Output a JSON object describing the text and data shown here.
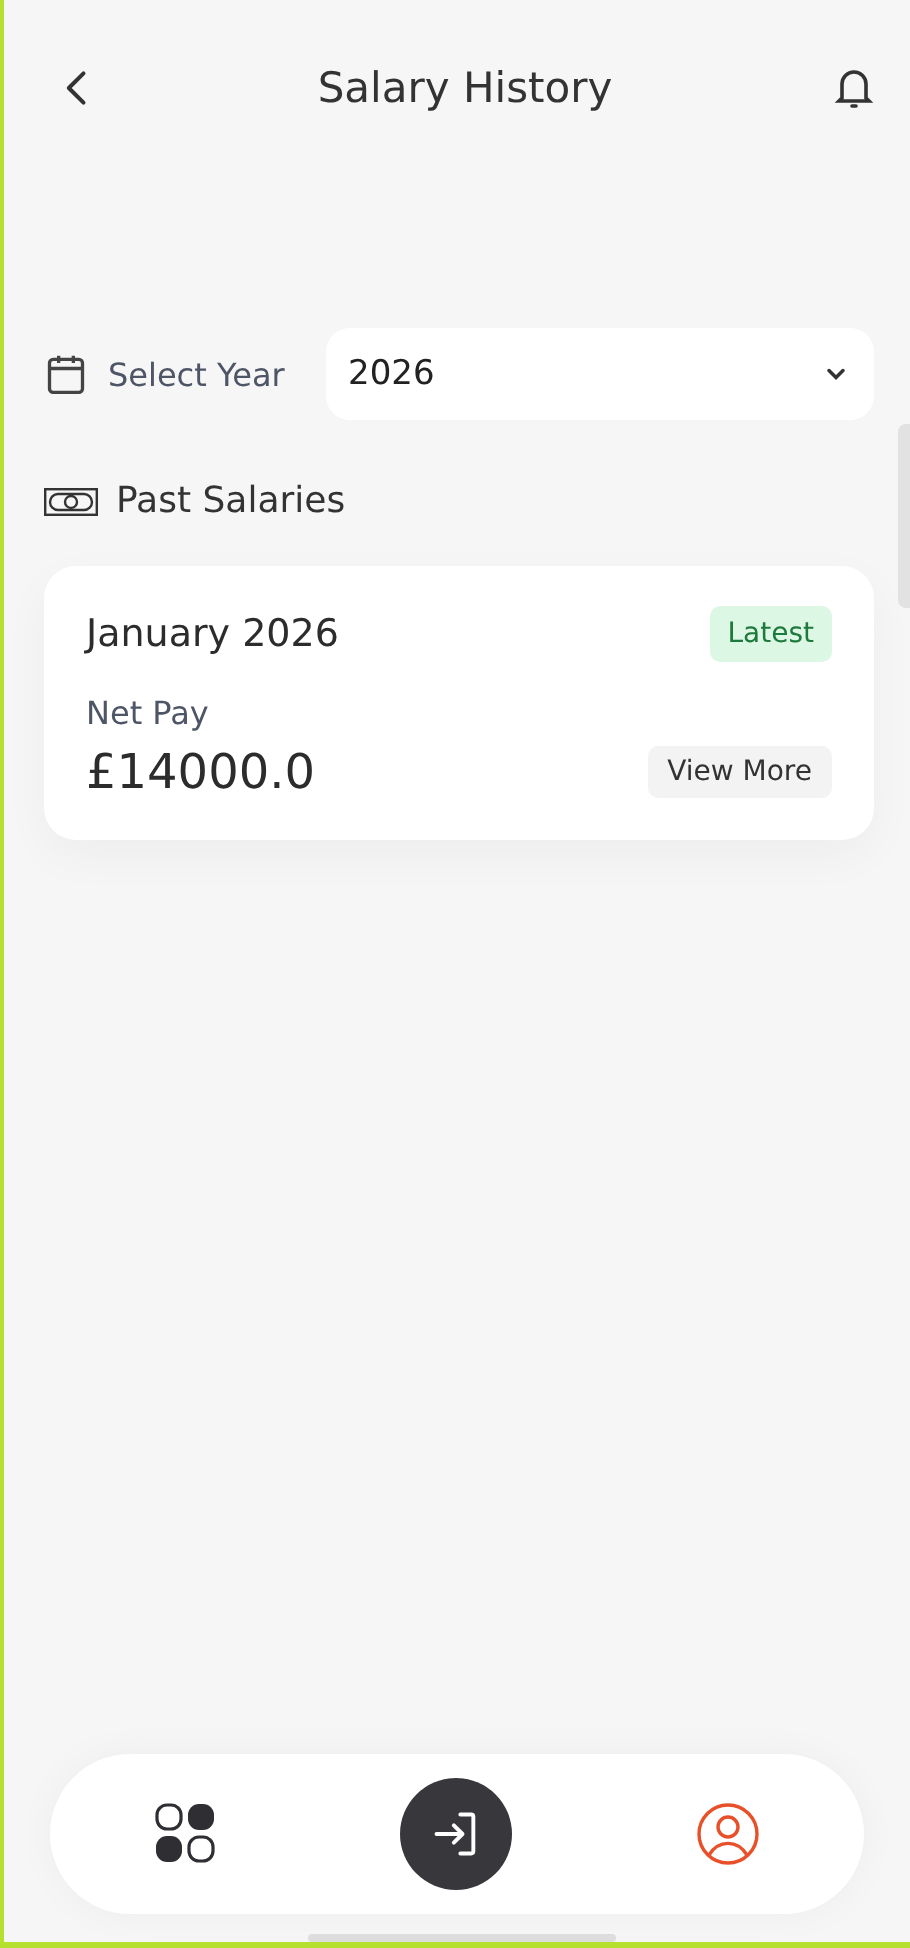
{
  "header": {
    "title": "Salary History"
  },
  "year_filter": {
    "label": "Select Year",
    "value": "2026"
  },
  "section": {
    "title": "Past Salaries"
  },
  "salaries": [
    {
      "month": "January 2026",
      "badge": "Latest",
      "net_pay_label": "Net Pay",
      "amount": "£14000.0",
      "action": "View More"
    }
  ],
  "nav": [
    {
      "kind": "grid",
      "selected": false
    },
    {
      "kind": "login",
      "selected": false
    },
    {
      "kind": "profile",
      "selected": true
    }
  ]
}
